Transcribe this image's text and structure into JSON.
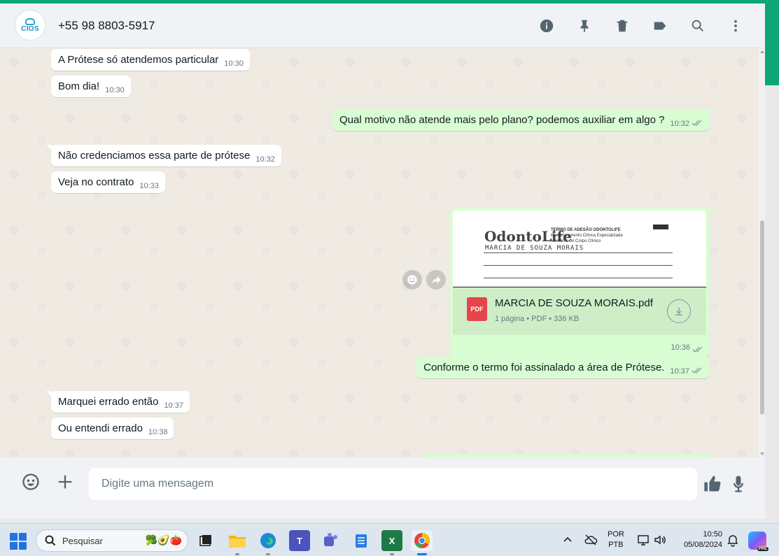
{
  "header": {
    "avatar_text": "CIOS",
    "contact_name": "+55 98 8803-5917"
  },
  "messages": [
    {
      "text": "A Prótese só atendemos particular",
      "time": "10:30"
    },
    {
      "text": "Bom dia!",
      "time": "10:30"
    },
    {
      "text": "Qual motivo não atende mais pelo plano? podemos auxiliar em algo ?",
      "time": "10:32"
    },
    {
      "text": "Não credenciamos essa parte de prótese",
      "time": "10:32"
    },
    {
      "text": "Veja no contrato",
      "time": "10:33"
    },
    {
      "text": "Conforme o termo foi assinalado a área de Prótese.",
      "time": "10:37"
    },
    {
      "text": "Marquei errado então",
      "time": "10:37"
    },
    {
      "text": "Ou entendi errado",
      "time": "10:38"
    }
  ],
  "document": {
    "preview_brand": "OdontoLife",
    "preview_title": "TERMO DE ADESÃO ODONTOLIFE",
    "preview_subtitle": "Credenciamento Clínica Especializada",
    "preview_subtitle2": "Membros do Corpo Clínico",
    "preview_name": "MARCIA DE SOUZA MORAIS",
    "icon_label": "PDF",
    "filename": "MARCIA DE SOUZA MORAIS.pdf",
    "meta": "1 página • PDF • 336 KB",
    "time": "10:36"
  },
  "composer": {
    "placeholder": "Digite uma mensagem"
  },
  "taskbar": {
    "search_placeholder": "Pesquisar",
    "search_deco": "🥦🥑🍅",
    "teams_label": "T",
    "excel_label": "X",
    "lang_line1": "POR",
    "lang_line2": "PTB",
    "time": "10:50",
    "date": "05/08/2024",
    "copilot_badge": "PRE"
  }
}
